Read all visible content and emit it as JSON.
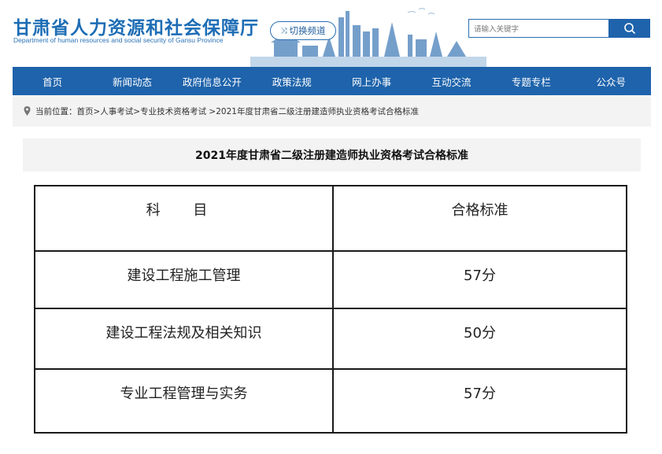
{
  "header": {
    "logo_cn": "甘肃省人力资源和社会保障厅",
    "logo_en": "Department of human resources and social security of Gansu Province",
    "switch_label": "切换频道",
    "search_placeholder": "请输入关键字"
  },
  "nav": {
    "items": [
      "首页",
      "新闻动态",
      "政府信息公开",
      "政策法规",
      "网上办事",
      "互动交流",
      "专题专栏",
      "公众号"
    ]
  },
  "breadcrumb": {
    "prefix": "当前位置：",
    "path": "首页>人事考试>专业技术资格考试 >2021年度甘肃省二级注册建造师执业资格考试合格标准"
  },
  "article": {
    "title": "2021年度甘肃省二级注册建造师执业资格考试合格标准"
  },
  "table": {
    "headers": [
      "科 目",
      "合格标准"
    ],
    "rows": [
      [
        "建设工程施工管理",
        "57分"
      ],
      [
        "建设工程法规及相关知识",
        "50分"
      ],
      [
        "专业工程管理与实务",
        "57分"
      ]
    ]
  },
  "colors": {
    "brand_blue": "#1e63ab",
    "breadcrumb_bg": "#f3f3f3"
  }
}
